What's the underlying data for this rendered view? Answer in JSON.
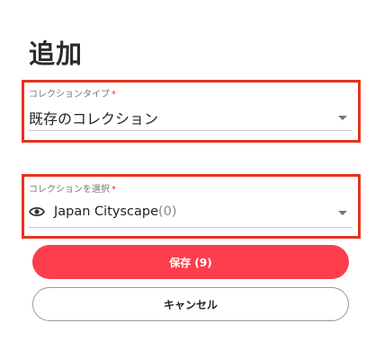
{
  "page": {
    "title": "追加"
  },
  "collection_type_field": {
    "label": "コレクションタイプ",
    "required_mark": "*",
    "value": "既存のコレクション"
  },
  "collection_select_field": {
    "label": "コレクションを選択",
    "required_mark": "*",
    "icon": "eye-icon",
    "value": "Japan Cityscape",
    "count": "(0)"
  },
  "actions": {
    "save_label": "保存 (9)",
    "cancel_label": "キャンセル"
  },
  "colors": {
    "highlight": "#e8321d",
    "primary_button": "#fc3d4c",
    "required_mark": "#e8321d"
  }
}
